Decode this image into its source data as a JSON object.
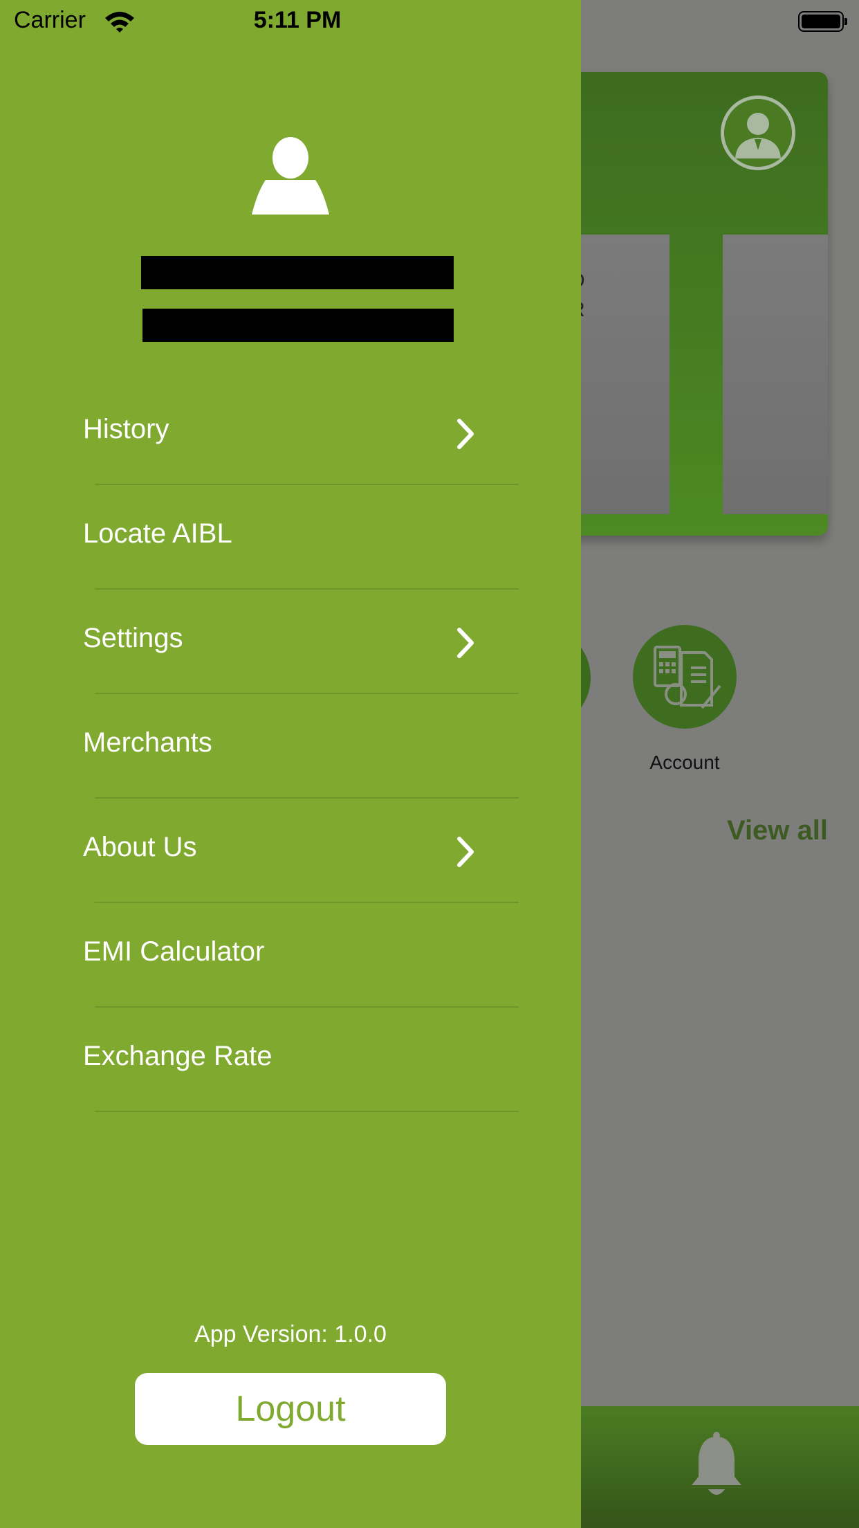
{
  "status_bar": {
    "carrier": "Carrier",
    "time": "5:11 PM"
  },
  "drawer": {
    "menu": [
      {
        "label": "History",
        "has_chevron": true
      },
      {
        "label": "Locate AIBL",
        "has_chevron": false
      },
      {
        "label": "Settings",
        "has_chevron": true
      },
      {
        "label": "Merchants",
        "has_chevron": false
      },
      {
        "label": "About Us",
        "has_chevron": true
      },
      {
        "label": "EMI Calculator",
        "has_chevron": false
      },
      {
        "label": "Exchange Rate",
        "has_chevron": false
      }
    ],
    "version": "App Version: 1.0.0",
    "logout_label": "Logout"
  },
  "background": {
    "panel_text_line1": "D",
    "panel_text_line2": "R",
    "account_label": "Account",
    "view_all": "View all"
  },
  "colors": {
    "drawer_green": "#80a930",
    "dark_green": "#3d6b1f"
  }
}
